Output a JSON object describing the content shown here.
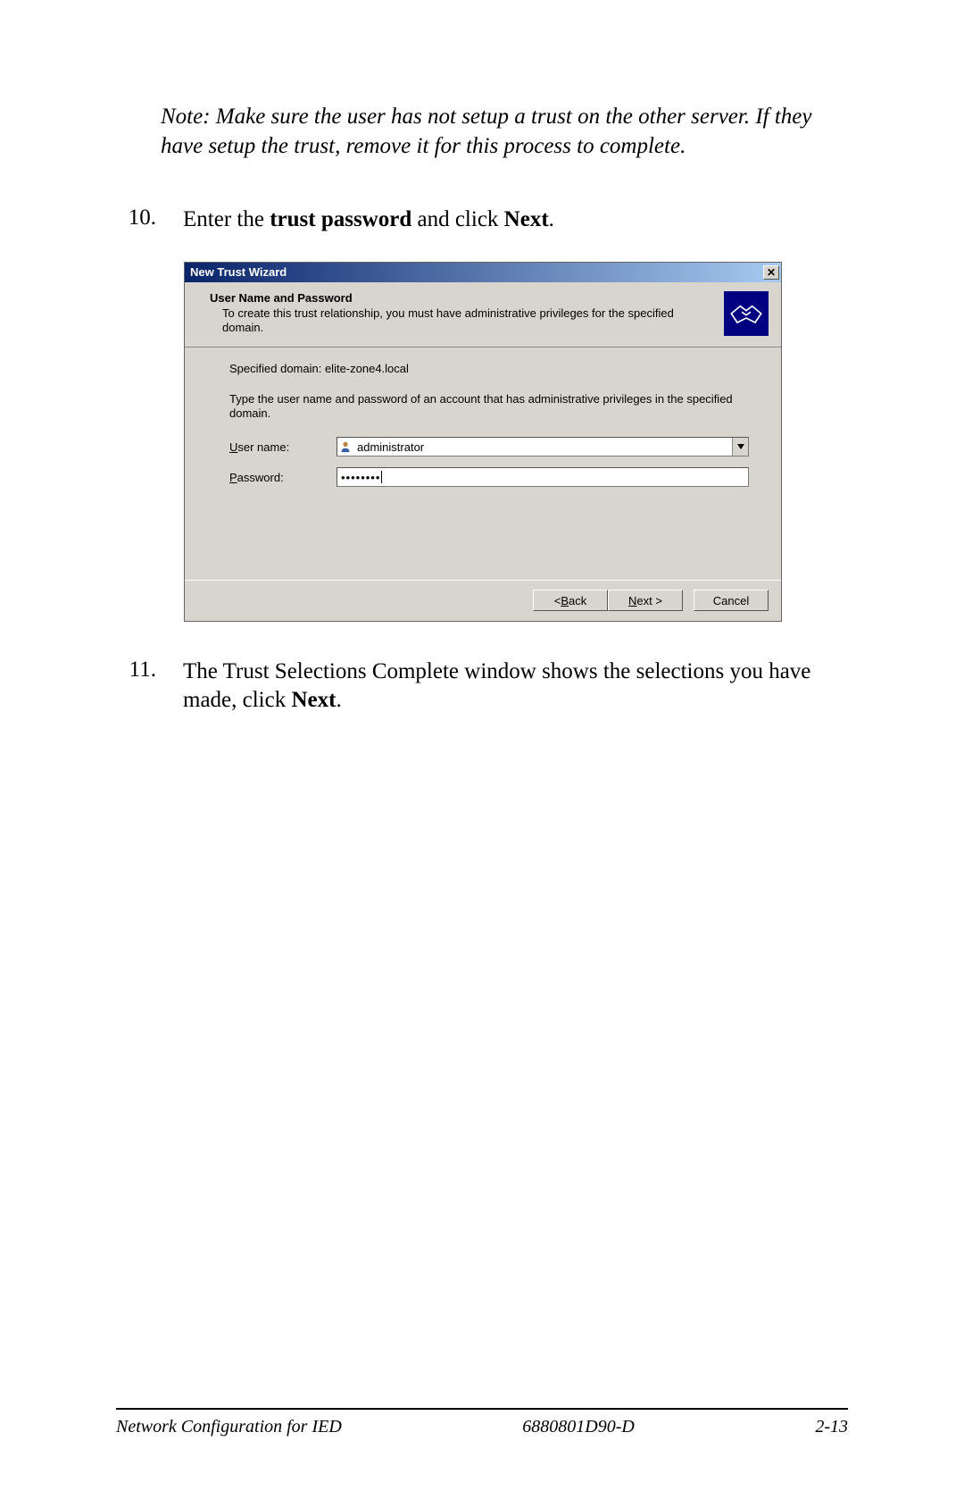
{
  "note_text": "Note: Make sure the user has not setup a trust on the other server. If they have setup the trust, remove it for this process to complete.",
  "steps": {
    "s10": {
      "num": "10.",
      "pre": "Enter the ",
      "b1": "trust password",
      "mid": " and click ",
      "b2": "Next",
      "post": "."
    },
    "s11": {
      "num": "11.",
      "pre": "The Trust Selections Complete window shows the selections you have made, click ",
      "b1": "Next",
      "post": "."
    }
  },
  "dialog": {
    "title": "New Trust Wizard",
    "close_glyph": "✕",
    "header_title": "User Name and Password",
    "header_sub": "To create this trust relationship, you must have administrative privileges for the specified domain.",
    "body": {
      "specified_line": "Specified domain: elite-zone4.local",
      "instruction": "Type the user name and password of an account that has administrative privileges in the specified domain.",
      "user_label_u": "U",
      "user_label_rest": "ser name:",
      "pass_label_u": "P",
      "pass_label_rest": "assword:",
      "user_value": "administrator",
      "password_mask": "••••••••"
    },
    "buttons": {
      "back_pre": "< ",
      "back_u": "B",
      "back_rest": "ack",
      "next_u": "N",
      "next_rest": "ext >",
      "cancel": "Cancel"
    }
  },
  "footer": {
    "left": "Network Configuration for IED",
    "center": "6880801D90-D",
    "right": "2-13"
  }
}
